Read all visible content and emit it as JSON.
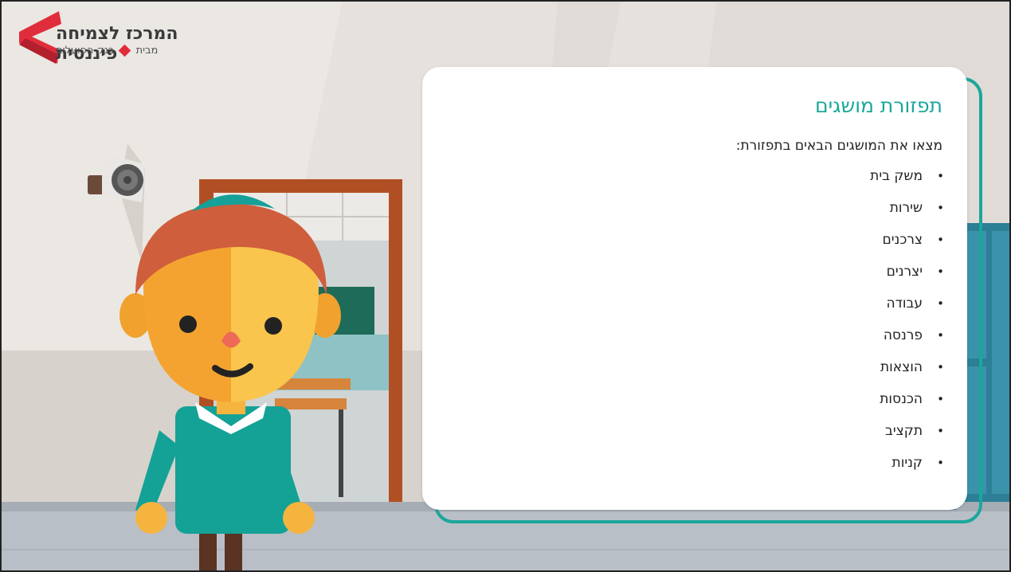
{
  "logo": {
    "title": "המרכז לצמיחה פיננסית",
    "sub_prefix": "מבית",
    "sub_bank": "בנק הפועלים"
  },
  "card": {
    "title": "תפזורת מושגים",
    "intro": "מצאו את המושגים הבאים בתפזורת:",
    "terms": [
      "משק בית",
      "שירות",
      "צרכנים",
      "יצרנים",
      "עבודה",
      "פרנסה",
      "הוצאות",
      "הכנסות",
      "תקציב",
      "קניות"
    ]
  },
  "colors": {
    "accent": "#1aa79b",
    "brand_red": "#e02d3c"
  },
  "icons": {
    "logo_mark": "red-chevron-logo-icon",
    "bullet": "bullet-dot-icon"
  }
}
